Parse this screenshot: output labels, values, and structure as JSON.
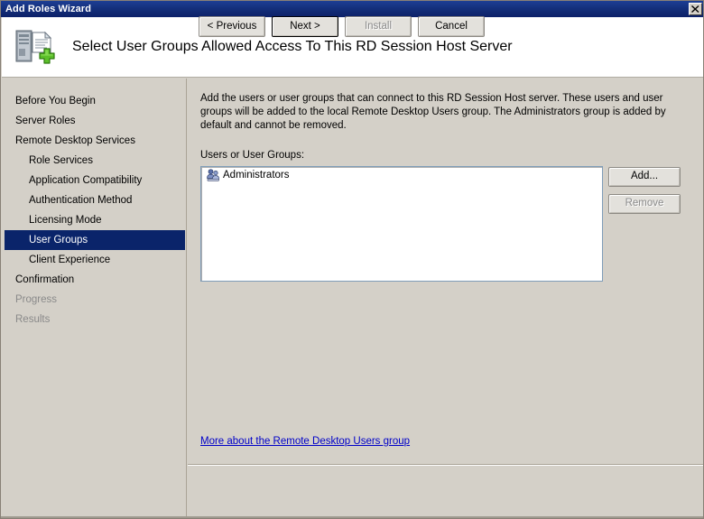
{
  "window": {
    "title": "Add Roles Wizard",
    "close_label": "×"
  },
  "header": {
    "title": "Select User Groups Allowed Access To This RD Session Host Server",
    "icon": "server-add-roles-icon"
  },
  "sidebar": {
    "items": [
      {
        "label": "Before You Begin",
        "level": 0,
        "state": "enabled"
      },
      {
        "label": "Server Roles",
        "level": 0,
        "state": "enabled"
      },
      {
        "label": "Remote Desktop Services",
        "level": 0,
        "state": "enabled"
      },
      {
        "label": "Role Services",
        "level": 1,
        "state": "enabled"
      },
      {
        "label": "Application Compatibility",
        "level": 1,
        "state": "enabled"
      },
      {
        "label": "Authentication Method",
        "level": 1,
        "state": "enabled"
      },
      {
        "label": "Licensing Mode",
        "level": 1,
        "state": "enabled"
      },
      {
        "label": "User Groups",
        "level": 1,
        "state": "selected"
      },
      {
        "label": "Client Experience",
        "level": 1,
        "state": "enabled"
      },
      {
        "label": "Confirmation",
        "level": 0,
        "state": "enabled"
      },
      {
        "label": "Progress",
        "level": 0,
        "state": "disabled"
      },
      {
        "label": "Results",
        "level": 0,
        "state": "disabled"
      }
    ]
  },
  "main": {
    "description": "Add the users or user groups that can connect to this RD Session Host server. These users and user groups will be added to the local Remote Desktop Users group. The Administrators group is added by default and cannot be removed.",
    "listbox_label": "Users or User Groups:",
    "listbox_items": [
      {
        "label": "Administrators",
        "icon": "user-group-icon"
      }
    ],
    "add_label": "Add...",
    "remove_label": "Remove",
    "link_label": "More about the Remote Desktop Users group"
  },
  "footer": {
    "previous_label": "< Previous",
    "next_label": "Next >",
    "install_label": "Install",
    "cancel_label": "Cancel"
  },
  "colors": {
    "titlebar_start": "#1d3f94",
    "titlebar_end": "#0c2068",
    "window_face": "#d4d0c8",
    "selection": "#0a246a",
    "link": "#0000c8",
    "disabled_text": "#8a8a8a"
  }
}
